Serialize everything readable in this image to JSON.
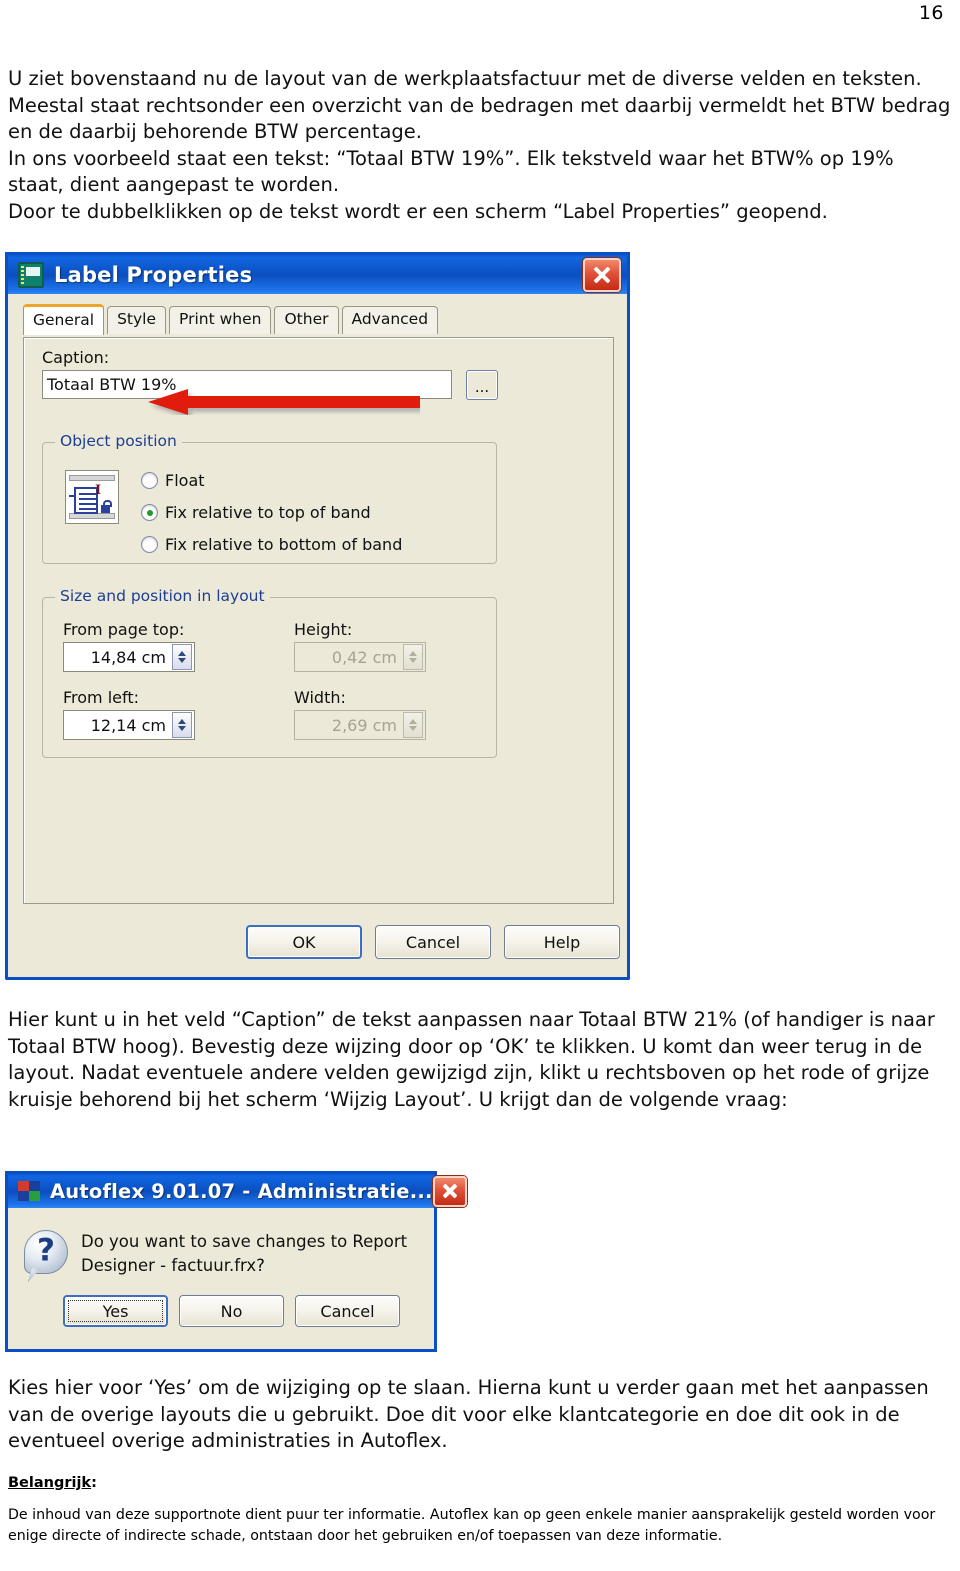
{
  "page": {
    "number": "16"
  },
  "paragraphs": {
    "intro": "U ziet bovenstaand nu de layout van de werkplaatsfactuur met de diverse velden en teksten. Meestal staat rechtsonder een overzicht van de bedragen met daarbij vermeldt het BTW bedrag en de daarbij behorende BTW percentage.\nIn ons voorbeeld staat een tekst: “Totaal BTW 19%”. Elk tekstveld waar het BTW% op 19% staat, dient aangepast te worden.\nDoor te dubbelklikken op de tekst wordt er een scherm “Label Properties” geopend.",
    "caption_instruction": "Hier kunt u in het veld “Caption” de tekst aanpassen naar Totaal BTW 21% (of handiger is naar Totaal BTW hoog). Bevestig deze wijzing door op ‘OK’ te klikken. U komt dan weer terug in de layout. Nadat eventuele andere velden gewijzigd zijn, klikt u rechtsboven op het rode of grijze kruisje behorend bij het scherm ‘Wijzig Layout’. U krijgt dan de volgende vraag:",
    "closing": "Kies hier voor ‘Yes’ om de wijziging op te slaan. Hierna kunt u verder gaan met het aanpassen van de overige layouts die u gebruikt. Doe dit voor elke klantcategorie en doe dit ook in de eventueel overige administraties in Autoflex.",
    "note_heading": "Belangrijk",
    "note_heading_suffix": ":",
    "disclaimer": "De inhoud van deze supportnote dient puur ter informatie. Autoflex kan op geen enkele manier aansprakelijk gesteld worden voor enige directe of indirecte schade, ontstaan door het gebruiken en/of toepassen van deze informatie."
  },
  "label_properties_dialog": {
    "title": "Label Properties",
    "close_label": "×",
    "tabs": [
      {
        "label": "General",
        "active": true
      },
      {
        "label": "Style",
        "active": false
      },
      {
        "label": "Print when",
        "active": false
      },
      {
        "label": "Other",
        "active": false
      },
      {
        "label": "Advanced",
        "active": false
      }
    ],
    "caption": {
      "label": "Caption:",
      "value": "Totaal BTW  19%",
      "placeholder": "",
      "ellipsis_button": "..."
    },
    "object_position": {
      "title": "Object position",
      "options": [
        {
          "label": "Float",
          "underline_char": "F",
          "selected": false
        },
        {
          "label": "Fix relative to top of band",
          "underline_char": "t",
          "selected": true
        },
        {
          "label": "Fix relative to bottom of band",
          "underline_char": "b",
          "selected": false
        }
      ]
    },
    "size_position": {
      "title": "Size and position in layout",
      "fields": [
        {
          "label": "From page top:",
          "value": "14,84 cm",
          "disabled": false
        },
        {
          "label": "Height:",
          "value": "0,42 cm",
          "disabled": true
        },
        {
          "label": "From left:",
          "value": "12,14 cm",
          "disabled": false
        },
        {
          "label": "Width:",
          "value": "2,69 cm",
          "disabled": true
        }
      ]
    },
    "buttons": [
      {
        "label": "OK",
        "default": true
      },
      {
        "label": "Cancel",
        "default": false
      },
      {
        "label": "Help",
        "default": false
      }
    ]
  },
  "autoflex_dialog": {
    "title": "Autoflex 9.01.07 - Administratie...",
    "close_label": "×",
    "message": "Do you want to save changes to Report\nDesigner - factuur.frx?",
    "buttons": [
      {
        "label": "Yes",
        "default": true
      },
      {
        "label": "No",
        "default": false
      },
      {
        "label": "Cancel",
        "default": false
      }
    ]
  },
  "colors": {
    "titlebar_blue": "#0b54c8",
    "dialog_face": "#ece9d8",
    "close_red": "#c32b14",
    "active_tab_accent": "#f0a22a",
    "group_title_blue": "#1c3f94",
    "radio_selected_green": "#1f9b2a",
    "annotation_arrow_red": "#e21b0c"
  }
}
